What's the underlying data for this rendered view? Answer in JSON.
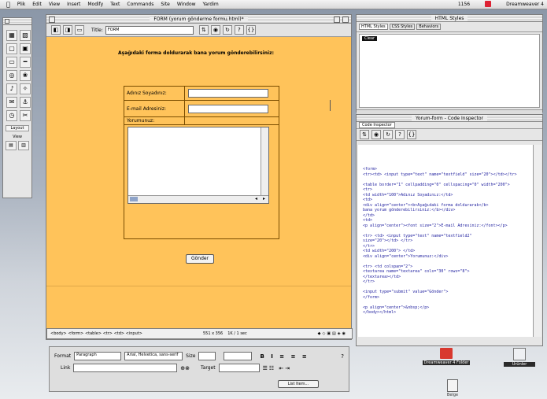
{
  "menubar": {
    "apple": "",
    "items": [
      "Plik",
      "Edit",
      "View",
      "Insert",
      "Modify",
      "Text",
      "Commands",
      "Site",
      "Window",
      "Yardim"
    ],
    "clock": "1156",
    "app_name": "Dreamweaver 4"
  },
  "tools": {
    "icons": [
      "table-icon",
      "layer-icon",
      "image-icon",
      "form-icon",
      "frame-icon",
      "hr-icon",
      "rollover-icon",
      "link-icon",
      "flash-icon",
      "shockwave-icon",
      "email-icon",
      "anchor-icon",
      "date-icon",
      "comment-icon"
    ],
    "glyphs": [
      "▦",
      "▧",
      "▢",
      "▣",
      "▭",
      "━",
      "◎",
      "❀",
      "♪",
      "✧",
      "✉",
      "⚓",
      "◷",
      "✂"
    ],
    "view_label": "Layout",
    "view_sub": "View"
  },
  "doc_window": {
    "title": "FORM (yorum gönderme formu.html)*",
    "title_field_label": "Title:",
    "title_field_value": "FORM",
    "heading": "Aşağıdaki forma doldurarak bana yorum gönderebilirsiniz:",
    "form": {
      "name_label": "Adınız Soyadınız:",
      "email_label": "E-mail Adresiniz:",
      "comment_label": "Yorumunuz:",
      "submit_label": "Gönder"
    },
    "status": {
      "tag_path": "<body> <form> <table> <tr> <td> <input>",
      "size": "551 x 356",
      "kb": "1K / 1 sec"
    }
  },
  "properties": {
    "format_label": "Format",
    "format_value": "Paragraph",
    "font_value": "Arial, Helvetica, sans-serif",
    "size_label": "Size",
    "size_value": "",
    "link_label": "Link",
    "target_label": "Target",
    "list_item_label": "List Item..."
  },
  "html_styles": {
    "title": "HTML Styles",
    "tabs": [
      "HTML Styles",
      "CSS Styles",
      "Behaviors"
    ],
    "selected_item": "Clear"
  },
  "code_inspector": {
    "title": "Code Inspector",
    "window_title": "Yorum-form - Code Inspector",
    "lines": [
      "<form>",
      "<tr><td> <input type=\"text\" name=\"textfield\" size=\"20\"></td></tr>",
      "",
      "<table border=\"1\" cellpadding=\"0\" cellspacing=\"0\" width=\"200\">",
      "<tr>",
      "<td width=\"100\">Adınız Soyadınız:</td>",
      "<td>",
      "<div align=\"center\"><b>Aşağıdaki forma doldurarak</b>",
      "bana yorum gönderebilirsiniz:</b></div>",
      "</td>",
      "<td>",
      "<p align=\"center\"><font size=\"2\">E-mail Adresiniz:</font></p>",
      "",
      "<tr> <td> <input type=\"text\" name=\"textfield2\"",
      "size=\"20\"></td> </tr>",
      "</tr>",
      "<td width=\"200\"> </td>",
      "<div align=\"center\">Yorumunuz:</div>",
      "",
      "<tr> <td colspan=\"2\">",
      "<textarea name=\"textarea\" cols=\"30\" rows=\"8\">",
      "</textarea></td>",
      "</tr>",
      "",
      "<input type=\"submit\" value=\"Gönder\">",
      "</form>",
      "",
      "<p align=\"center\">&nbsp;</p>",
      "</body></html>"
    ]
  },
  "desktop_icons": [
    {
      "label": "Dreamweaver 4 Folder",
      "icon": "folder-icon"
    },
    {
      "label": "Ürünler",
      "icon": "drive-icon"
    },
    {
      "label": "Belge",
      "icon": "document-icon"
    }
  ],
  "colors": {
    "page_bg": "#ffc35a",
    "code_text": "#1d1d9e"
  }
}
